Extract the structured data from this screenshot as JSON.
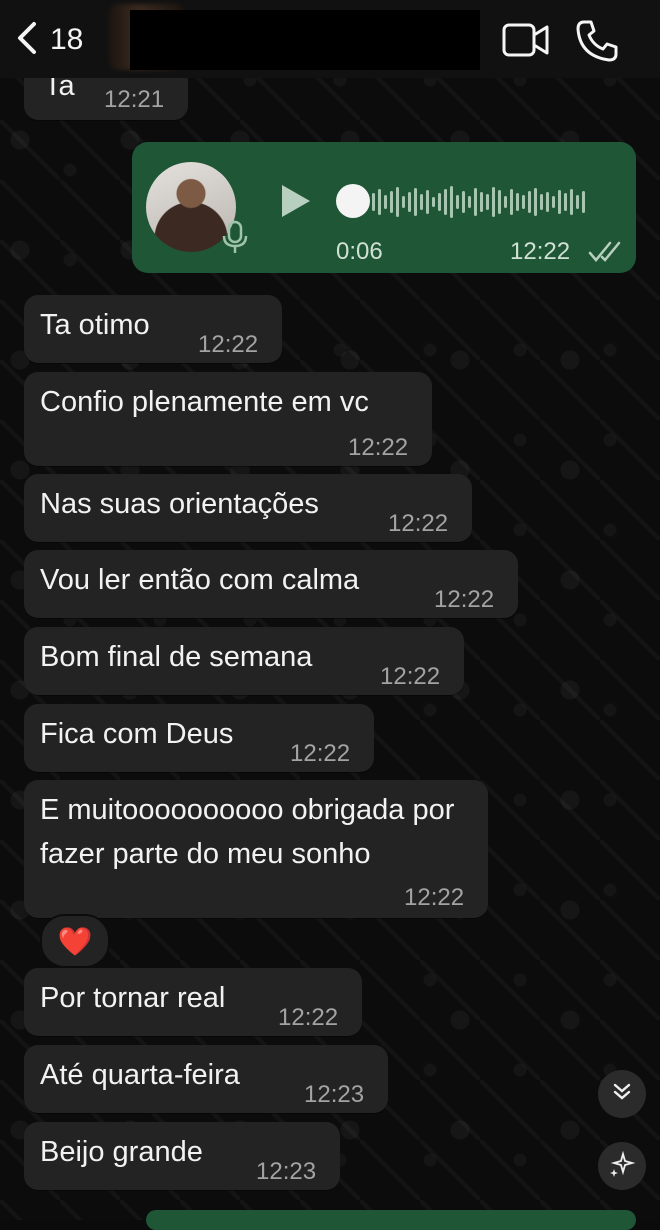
{
  "header": {
    "back_count": "18",
    "video_call_icon": "video-camera-icon",
    "voice_call_icon": "phone-icon"
  },
  "partial_message": {
    "text": "Ta",
    "time": "12:21"
  },
  "voice_message": {
    "duration": "0:06",
    "time": "12:22",
    "status_icon": "double-check-icon",
    "playback_progress": 0.0
  },
  "messages": [
    {
      "text": "Ta otimo",
      "time": "12:22"
    },
    {
      "text": "Confio plenamente em vc",
      "time": "12:22"
    },
    {
      "text": "Nas suas orientações",
      "time": "12:22"
    },
    {
      "text": "Vou ler então com calma",
      "time": "12:22"
    },
    {
      "text": "Bom final de semana",
      "time": "12:22"
    },
    {
      "text": "Fica com Deus",
      "time": "12:22"
    },
    {
      "text": "E muitoooooooooo obrigada por fazer parte do meu sonho",
      "time": "12:22",
      "reaction": "❤️"
    },
    {
      "text": "Por tornar real",
      "time": "12:22"
    },
    {
      "text": "Até quarta-feira",
      "time": "12:23"
    },
    {
      "text": "Beijo grande",
      "time": "12:23"
    }
  ],
  "colors": {
    "incoming_bubble": "#232323",
    "outgoing_bubble": "#1f5636",
    "background": "#0c0c0c",
    "timestamp": "#a3a3a3"
  },
  "buttons": {
    "scroll_down_icon": "double-chevron-down-icon",
    "sparkle_icon": "sparkle-icon"
  }
}
